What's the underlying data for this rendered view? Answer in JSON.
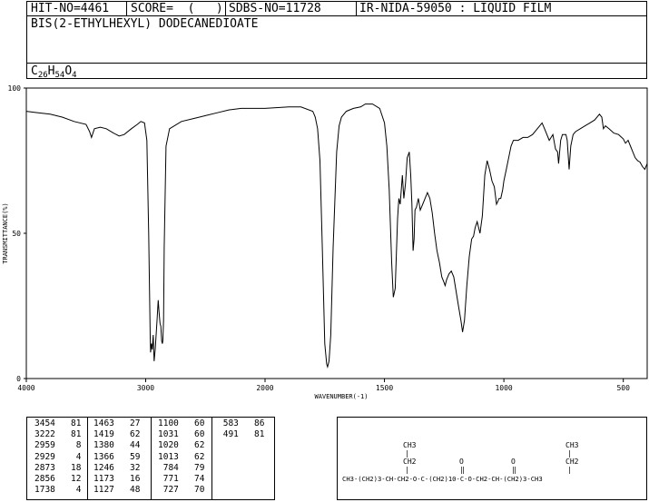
{
  "header": {
    "hit_no": "HIT-NO=4461",
    "score": "SCORE=  (   )",
    "sdbs_no": "SDBS-NO=11728",
    "ir_id": "IR-NIDA-59050 : LIQUID FILM"
  },
  "compound": {
    "name": "BIS(2-ETHYLHEXYL) DODECANEDIOATE",
    "formula_parts": [
      "C",
      "26",
      "H",
      "54",
      "O",
      "4"
    ]
  },
  "chart_data": {
    "type": "line",
    "xlabel": "WAVENUMBER(-1)",
    "ylabel": "TRANSMITTANCE(%)",
    "xlim": [
      4000,
      400
    ],
    "ylim": [
      0,
      100
    ],
    "x_ticks": [
      "4000",
      "3000",
      "2000",
      "1500",
      "1000",
      "500"
    ],
    "x_tick_values": [
      4000,
      3000,
      2000,
      1500,
      1000,
      500
    ],
    "y_ticks": [
      "100",
      "50",
      "0"
    ],
    "y_tick_values": [
      100,
      50,
      0
    ],
    "series": [
      {
        "points": [
          [
            4000,
            92
          ],
          [
            3900,
            91.5
          ],
          [
            3800,
            91
          ],
          [
            3700,
            90
          ],
          [
            3600,
            88.5
          ],
          [
            3500,
            87.5
          ],
          [
            3470,
            85
          ],
          [
            3454,
            83
          ],
          [
            3430,
            86
          ],
          [
            3380,
            86.5
          ],
          [
            3330,
            86
          ],
          [
            3270,
            84.5
          ],
          [
            3222,
            83.5
          ],
          [
            3180,
            84
          ],
          [
            3120,
            86
          ],
          [
            3070,
            87.5
          ],
          [
            3040,
            88.5
          ],
          [
            3010,
            88
          ],
          [
            2990,
            82
          ],
          [
            2975,
            50
          ],
          [
            2962,
            14
          ],
          [
            2959,
            9
          ],
          [
            2952,
            12
          ],
          [
            2945,
            10
          ],
          [
            2937,
            15
          ],
          [
            2929,
            6
          ],
          [
            2920,
            10
          ],
          [
            2905,
            20
          ],
          [
            2895,
            27
          ],
          [
            2888,
            23
          ],
          [
            2880,
            19
          ],
          [
            2873,
            18
          ],
          [
            2866,
            13
          ],
          [
            2860,
            12
          ],
          [
            2856,
            13
          ],
          [
            2850,
            20
          ],
          [
            2845,
            45
          ],
          [
            2830,
            80
          ],
          [
            2800,
            86
          ],
          [
            2700,
            88.5
          ],
          [
            2600,
            89.5
          ],
          [
            2500,
            90.5
          ],
          [
            2400,
            91.5
          ],
          [
            2300,
            92.5
          ],
          [
            2200,
            93
          ],
          [
            2100,
            93
          ],
          [
            2000,
            93
          ],
          [
            1900,
            93.5
          ],
          [
            1850,
            93.5
          ],
          [
            1800,
            92
          ],
          [
            1790,
            90
          ],
          [
            1780,
            86
          ],
          [
            1770,
            75
          ],
          [
            1760,
            45
          ],
          [
            1750,
            12
          ],
          [
            1742,
            5
          ],
          [
            1738,
            4
          ],
          [
            1732,
            6
          ],
          [
            1725,
            15
          ],
          [
            1715,
            45
          ],
          [
            1700,
            78
          ],
          [
            1690,
            87
          ],
          [
            1680,
            90
          ],
          [
            1660,
            92
          ],
          [
            1630,
            93
          ],
          [
            1600,
            93.5
          ],
          [
            1580,
            94.5
          ],
          [
            1550,
            94.5
          ],
          [
            1520,
            93
          ],
          [
            1500,
            88
          ],
          [
            1490,
            80
          ],
          [
            1480,
            65
          ],
          [
            1470,
            40
          ],
          [
            1463,
            28
          ],
          [
            1455,
            31
          ],
          [
            1445,
            55
          ],
          [
            1440,
            62
          ],
          [
            1434,
            60
          ],
          [
            1425,
            70
          ],
          [
            1419,
            62
          ],
          [
            1412,
            67
          ],
          [
            1405,
            76
          ],
          [
            1396,
            78
          ],
          [
            1390,
            70
          ],
          [
            1385,
            60
          ],
          [
            1380,
            44
          ],
          [
            1376,
            48
          ],
          [
            1372,
            58
          ],
          [
            1366,
            59
          ],
          [
            1358,
            62
          ],
          [
            1350,
            58
          ],
          [
            1340,
            60
          ],
          [
            1330,
            62
          ],
          [
            1320,
            64
          ],
          [
            1310,
            62
          ],
          [
            1300,
            57
          ],
          [
            1290,
            50
          ],
          [
            1280,
            44
          ],
          [
            1270,
            40
          ],
          [
            1260,
            35
          ],
          [
            1250,
            33
          ],
          [
            1246,
            32
          ],
          [
            1240,
            34
          ],
          [
            1230,
            36
          ],
          [
            1220,
            37
          ],
          [
            1210,
            35
          ],
          [
            1200,
            30
          ],
          [
            1190,
            25
          ],
          [
            1180,
            20
          ],
          [
            1173,
            16
          ],
          [
            1165,
            20
          ],
          [
            1155,
            32
          ],
          [
            1145,
            42
          ],
          [
            1135,
            48
          ],
          [
            1127,
            49
          ],
          [
            1120,
            52
          ],
          [
            1112,
            54
          ],
          [
            1100,
            50
          ],
          [
            1090,
            56
          ],
          [
            1080,
            70
          ],
          [
            1070,
            75
          ],
          [
            1060,
            72
          ],
          [
            1050,
            68
          ],
          [
            1040,
            66
          ],
          [
            1031,
            60
          ],
          [
            1025,
            61
          ],
          [
            1020,
            62
          ],
          [
            1013,
            62
          ],
          [
            1005,
            65
          ],
          [
            1000,
            68
          ],
          [
            990,
            72
          ],
          [
            980,
            76
          ],
          [
            970,
            80
          ],
          [
            960,
            82
          ],
          [
            940,
            82
          ],
          [
            920,
            83
          ],
          [
            900,
            83
          ],
          [
            880,
            84
          ],
          [
            860,
            86
          ],
          [
            840,
            88
          ],
          [
            830,
            86
          ],
          [
            810,
            82
          ],
          [
            795,
            84
          ],
          [
            784,
            79
          ],
          [
            775,
            78
          ],
          [
            771,
            74
          ],
          [
            762,
            82
          ],
          [
            755,
            84
          ],
          [
            740,
            84
          ],
          [
            735,
            82
          ],
          [
            727,
            72
          ],
          [
            720,
            80
          ],
          [
            710,
            84
          ],
          [
            700,
            85
          ],
          [
            680,
            86
          ],
          [
            660,
            87
          ],
          [
            640,
            88
          ],
          [
            620,
            89
          ],
          [
            600,
            91
          ],
          [
            590,
            90
          ],
          [
            583,
            86
          ],
          [
            575,
            87
          ],
          [
            560,
            86
          ],
          [
            540,
            84.5
          ],
          [
            520,
            84
          ],
          [
            500,
            82.5
          ],
          [
            491,
            81
          ],
          [
            480,
            82
          ],
          [
            470,
            80
          ],
          [
            460,
            78
          ],
          [
            450,
            76
          ],
          [
            440,
            75
          ],
          [
            430,
            74.5
          ],
          [
            420,
            73
          ],
          [
            410,
            72
          ],
          [
            400,
            74
          ]
        ]
      }
    ]
  },
  "peak_table": [
    [
      "3454",
      "81"
    ],
    [
      "3222",
      "81"
    ],
    [
      "2959",
      "8"
    ],
    [
      "2929",
      "4"
    ],
    [
      "2873",
      "18"
    ],
    [
      "2856",
      "12"
    ],
    [
      "1738",
      "4"
    ],
    [
      "1463",
      "27"
    ],
    [
      "1419",
      "62"
    ],
    [
      "1380",
      "44"
    ],
    [
      "1366",
      "59"
    ],
    [
      "1246",
      "32"
    ],
    [
      "1173",
      "16"
    ],
    [
      "1127",
      "48"
    ],
    [
      "1100",
      "60"
    ],
    [
      "1031",
      "60"
    ],
    [
      "1020",
      "62"
    ],
    [
      "1013",
      "62"
    ],
    [
      "784",
      "79"
    ],
    [
      "771",
      "74"
    ],
    [
      "727",
      "70"
    ],
    [
      "583",
      "86"
    ],
    [
      "491",
      "81"
    ]
  ],
  "structure": {
    "ch3_top": "CH3",
    "ch2_mid": "CH2",
    "o_marks": "O",
    "main_chain": "CH3-(CH2)3-CH-CH2-O-C-(CH2)10-C-O-CH2-CH-(CH2)3-CH3"
  }
}
